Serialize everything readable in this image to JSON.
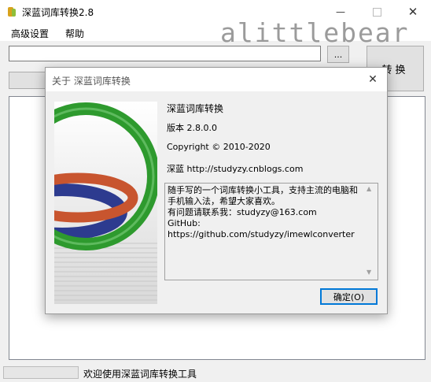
{
  "window": {
    "title": "深蓝词库转换2.8",
    "minimize_icon": "minimize-icon",
    "maximize_icon": "maximize-icon",
    "close_icon": "close-icon"
  },
  "menu": {
    "items": [
      {
        "label": "高级设置"
      },
      {
        "label": "帮助"
      }
    ]
  },
  "watermark": "alittlebear",
  "toolbar": {
    "path_value": "",
    "browse_label": "...",
    "convert_label": "转换"
  },
  "status": {
    "text": "欢迎使用深蓝词库转换工具"
  },
  "about": {
    "title": "关于 深蓝词库转换",
    "product_name": "深蓝词库转换",
    "version": "版本 2.8.0.0",
    "copyright": "Copyright © 2010-2020",
    "author": "深蓝 http://studyzy.cnblogs.com",
    "description": "随手写的一个词库转换小工具，支持主流的电脑和手机输入法，希望大家喜欢。\n有问题请联系我：studyzy@163.com\nGitHub: https://github.com/studyzy/imewlconverter",
    "ok_label": "确定(O)"
  },
  "colors": {
    "accent": "#0078d7",
    "ring_green": "#2e9a2e",
    "ring_blue": "#2d3b8f",
    "ring_red": "#c8552f"
  }
}
